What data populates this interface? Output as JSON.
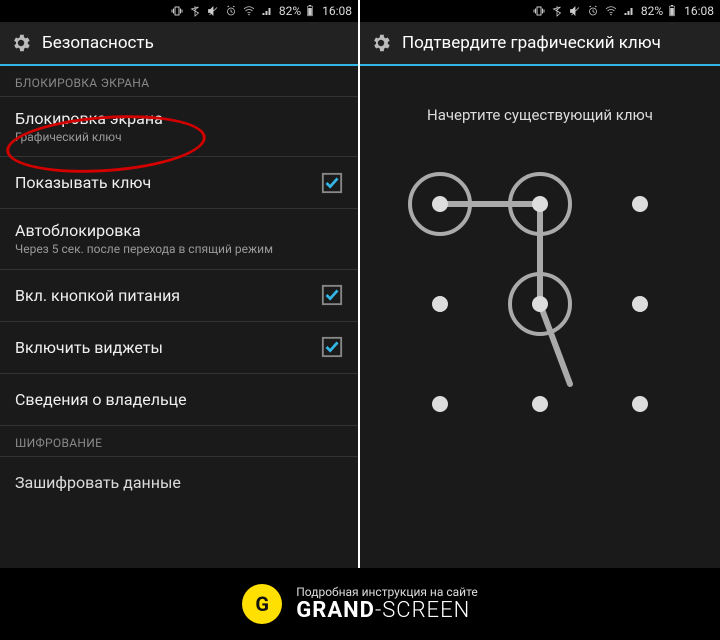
{
  "statusbar": {
    "battery_percent": "82%",
    "time": "16:08"
  },
  "left": {
    "header_title": "Безопасность",
    "section_lock": "БЛОКИРОВКА ЭКРАНА",
    "items": {
      "screen_lock": {
        "title": "Блокировка экрана",
        "subtitle": "Графический ключ"
      },
      "show_pattern": {
        "title": "Показывать ключ"
      },
      "auto_lock": {
        "title": "Автоблокировка",
        "subtitle": "Через 5 сек. после перехода в спящий режим"
      },
      "power_lock": {
        "title": "Вкл. кнопкой питания"
      },
      "enable_widgets": {
        "title": "Включить виджеты"
      },
      "owner_info": {
        "title": "Сведения о владельце"
      }
    },
    "section_encrypt": "ШИФРОВАНИЕ",
    "encrypt": {
      "title": "Зашифровать данные"
    }
  },
  "right": {
    "header_title": "Подтвердите графический ключ",
    "instruction": "Начертите существующий ключ"
  },
  "banner": {
    "logo_letter": "G",
    "subtitle": "Подробная инструкция на сайте",
    "brand_bold": "GRAND",
    "brand_light": "SCREEN"
  }
}
